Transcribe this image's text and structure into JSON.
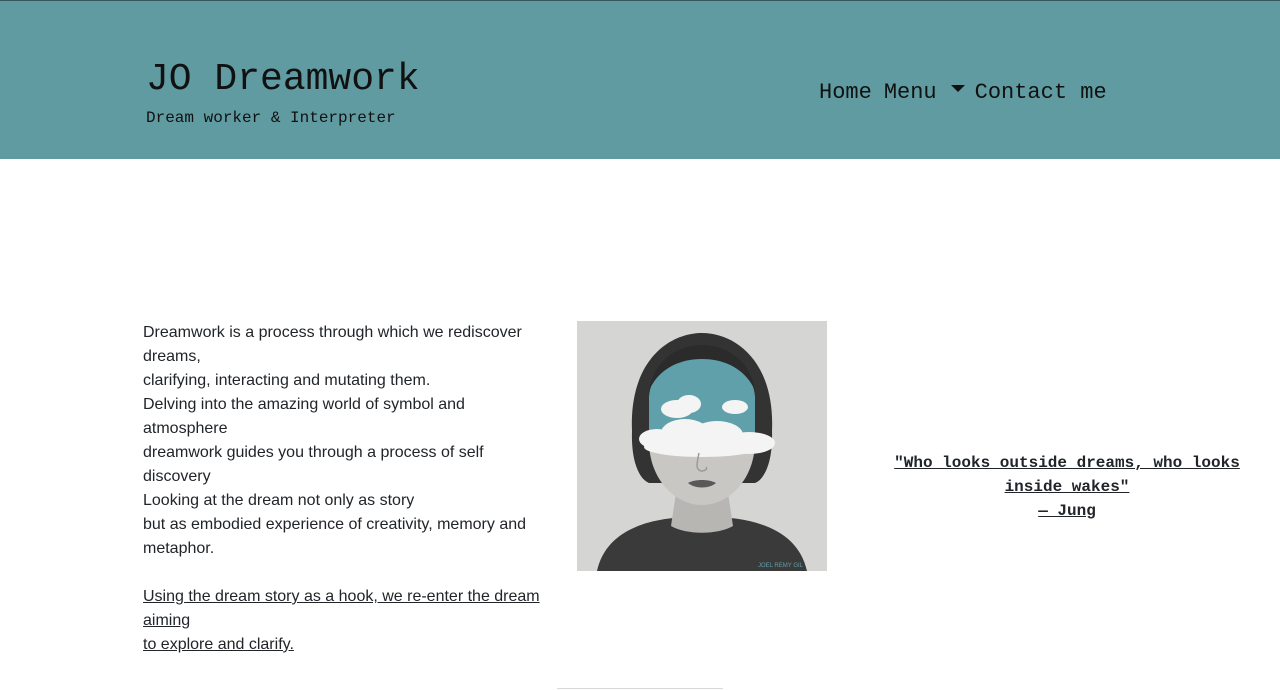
{
  "header": {
    "title": "JO Dreamwork",
    "tagline": "Dream worker & Interpreter",
    "background_color": "#5f9ba1"
  },
  "nav": {
    "home": "Home",
    "menu": "Menu",
    "menu_icon": "caret-down-icon",
    "contact": "Contact me"
  },
  "intro": {
    "lines": [
      "Dreamwork is a process through which we rediscover dreams,",
      "clarifying, interacting and mutating them.",
      "Delving into the amazing world of symbol and atmosphere",
      "dreamwork guides you through a process of self discovery",
      "Looking at the dream not only as story",
      "but as embodied experience of creativity, memory and metaphor."
    ],
    "link_lines": [
      "Using the dream story as a hook, we re-enter the dream aiming",
      "to explore and clarify."
    ]
  },
  "image": {
    "alt": "Portrait of a woman whose eyes are covered by clouds in a blue sky",
    "signature": "JOEL REMY GIL",
    "accent_color": "#5fa0ab"
  },
  "quote": {
    "text": "\"Who looks outside dreams, who looks inside wakes\"",
    "author": "— Jung"
  }
}
